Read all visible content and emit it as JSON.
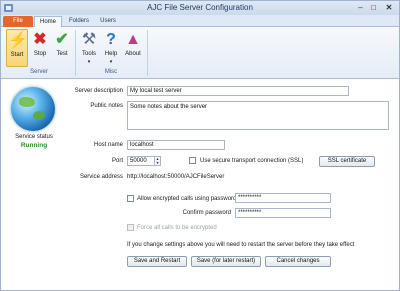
{
  "window": {
    "title": "AJC File Server Configuration",
    "minimize": "–",
    "maximize": "□",
    "close": "✕"
  },
  "tabs": {
    "file": "File",
    "home": "Home",
    "folders": "Folders",
    "users": "Users"
  },
  "ribbon": {
    "start": "Start",
    "stop": "Stop",
    "test": "Test",
    "tools": "Tools",
    "help": "Help",
    "about": "About",
    "dropdown_arrow": "▾",
    "group_server": "Server",
    "group_misc": "Misc"
  },
  "status": {
    "label": "Service status",
    "value": "Running"
  },
  "form": {
    "server_description_label": "Server description",
    "server_description_value": "My local test server",
    "public_notes_label": "Public notes",
    "public_notes_value": "Some notes about the server",
    "host_name_label": "Host name",
    "host_name_value": "localhost",
    "port_label": "Port",
    "port_value": "50000",
    "secure_transport_label": "Use secure transport connection (SSL)",
    "ssl_certificate_button": "SSL certificate",
    "service_address_label": "Service address",
    "service_address_value": "http://localhost:50000/AJCFileServer",
    "allow_encrypted_label": "Allow encrypted calls using password",
    "password_value": "**********",
    "confirm_password_label": "Confirm password",
    "confirm_password_value": "**********",
    "force_encrypted_label": "Force all calls to be encrypted",
    "restart_notice": "If you change settings above you will need to restart the server before they take effect",
    "save_restart_button": "Save and Restart",
    "save_later_button": "Save (for later restart)",
    "cancel_button": "Cancel changes"
  },
  "colors": {
    "accent": "#e5662a",
    "running": "#2e8b2e",
    "start_highlight": "#f8d57a"
  }
}
